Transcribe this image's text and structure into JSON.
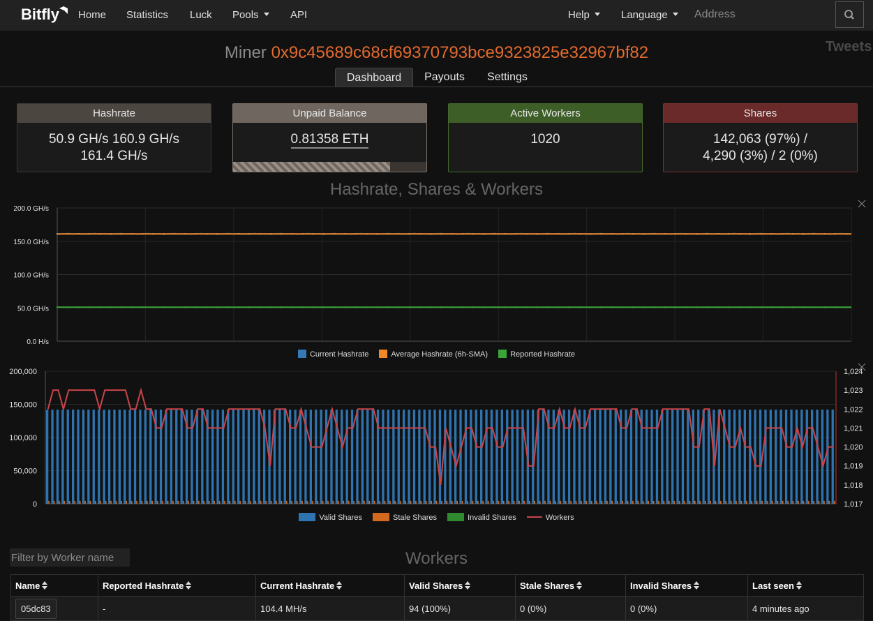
{
  "nav": {
    "brand": "Bitfly",
    "links": [
      "Home",
      "Statistics",
      "Luck",
      "Pools",
      "API"
    ],
    "help": "Help",
    "language": "Language",
    "address_placeholder": "Address"
  },
  "tweets_label": "Tweets",
  "miner": {
    "label": "Miner",
    "address": "0x9c45689c68cf69370793bce9323825e32967bf82"
  },
  "tabs": [
    "Dashboard",
    "Payouts",
    "Settings"
  ],
  "cards": {
    "hashrate": {
      "title": "Hashrate",
      "line1": "50.9 GH/s 160.9 GH/s",
      "line2": "161.4 GH/s"
    },
    "balance": {
      "title": "Unpaid Balance",
      "value": "0.81358 ETH",
      "progress": 0.81358
    },
    "workers": {
      "title": "Active Workers",
      "value": "1020"
    },
    "shares": {
      "title": "Shares",
      "line1": "142,063 (97%) /",
      "line2": "4,290 (3%) / 2 (0%)"
    }
  },
  "colors": {
    "hashrate_card": "#4b4640",
    "balance_card": "#6f675f",
    "workers_card": "#3d5e27",
    "shares_card": "#6b2a2a",
    "current": "#337ab7",
    "average": "#f0882a",
    "reported": "#3aa43a",
    "valid": "#2e74b0",
    "stale": "#d2691e",
    "invalid": "#2f8a2f",
    "workers_line": "#c9454b"
  },
  "charts_title": "Hashrate, Shares & Workers",
  "workers_title": "Workers",
  "filter_placeholder": "Filter by Worker name",
  "chart_data": [
    {
      "type": "line",
      "title": "",
      "ylabel": "",
      "y_unit": "GH/s",
      "ylim": [
        0,
        200
      ],
      "yticks": [
        "0.0 H/s",
        "50.0 GH/s",
        "100.0 GH/s",
        "150.0 GH/s",
        "200.0 GH/s"
      ],
      "grid": true,
      "legend": "bottom",
      "series": [
        {
          "name": "Current Hashrate",
          "color": "#337ab7",
          "value_approx": 161
        },
        {
          "name": "Average Hashrate (6h-SMA)",
          "color": "#f0882a",
          "value_approx": 161
        },
        {
          "name": "Reported Hashrate",
          "color": "#3aa43a",
          "value_approx": 51
        }
      ]
    },
    {
      "type": "bar",
      "title": "",
      "ylim_left": [
        0,
        200000
      ],
      "yticks_left": [
        "0",
        "50,000",
        "100,000",
        "150,000",
        "200,000"
      ],
      "ylim_right": [
        1017,
        1024
      ],
      "yticks_right": [
        "1,017",
        "1,018",
        "1,019",
        "1,020",
        "1,021",
        "1,022",
        "1,023",
        "1,024"
      ],
      "legend": "bottom",
      "series": [
        {
          "name": "Valid Shares",
          "color": "#2e74b0",
          "value_approx": 142000
        },
        {
          "name": "Stale Shares",
          "color": "#d2691e",
          "value_approx": 4300
        },
        {
          "name": "Invalid Shares",
          "color": "#2f8a2f",
          "value_approx": 2
        },
        {
          "name": "Workers",
          "color": "#c9454b",
          "values": [
            1022,
            1023,
            1023,
            1022,
            1023,
            1023,
            1023,
            1023,
            1023,
            1023,
            1022,
            1023,
            1023,
            1023,
            1023,
            1023,
            1022,
            1022,
            1023,
            1022,
            1022,
            1021,
            1021,
            1022,
            1022,
            1022,
            1022,
            1021,
            1021,
            1022,
            1022,
            1021,
            1021,
            1021,
            1021,
            1022,
            1022,
            1022,
            1022,
            1022,
            1022,
            1022,
            1021,
            1019,
            1022,
            1022,
            1022,
            1021,
            1021,
            1022,
            1021,
            1020,
            1020,
            1020,
            1021,
            1022,
            1021,
            1020,
            1021,
            1021,
            1022,
            1022,
            1022,
            1022,
            1021,
            1021,
            1021,
            1021,
            1021,
            1021,
            1021,
            1021,
            1021,
            1021,
            1020,
            1020,
            1018,
            1021,
            1020,
            1019,
            1020,
            1021,
            1021,
            1020,
            1020,
            1021,
            1021,
            1020,
            1020,
            1021,
            1021,
            1021,
            1021,
            1019,
            1019,
            1022,
            1022,
            1021,
            1021,
            1022,
            1021,
            1021,
            1022,
            1021,
            1021,
            1022,
            1022,
            1022,
            1022,
            1022,
            1022,
            1021,
            1021,
            1022,
            1022,
            1021,
            1021,
            1021,
            1021,
            1022,
            1022,
            1022,
            1022,
            1022,
            1022,
            1020,
            1020,
            1022,
            1022,
            1019,
            1022,
            1021,
            1020,
            1020,
            1021,
            1020,
            1020,
            1019,
            1019,
            1021,
            1021,
            1021,
            1021,
            1020,
            1020,
            1021,
            1020,
            1021,
            1021,
            1020,
            1019,
            1020,
            1020
          ]
        }
      ]
    }
  ],
  "table": {
    "headers": [
      "Name",
      "Reported Hashrate",
      "Current Hashrate",
      "Valid Shares",
      "Stale Shares",
      "Invalid Shares",
      "Last seen"
    ],
    "rows": [
      [
        "05dc83",
        "-",
        "104.4 MH/s",
        "94 (100%)",
        "0 (0%)",
        "0 (0%)",
        "4 minutes ago"
      ]
    ]
  }
}
